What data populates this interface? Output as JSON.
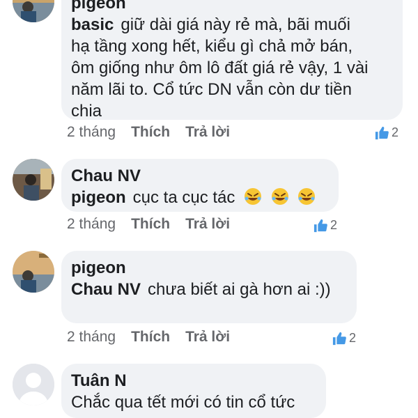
{
  "comments": [
    {
      "author": "pigeon",
      "mention": "basic",
      "lines": [
        "giữ dài giá này rẻ mà, bãi muối",
        "hạ tầng xong hết, kiểu gì chả mở bán,",
        "ôm giống như ôm lô đất giá rẻ vậy, 1 vài",
        "năm lãi to. Cổ tức DN vẫn còn dư tiền",
        "chia"
      ],
      "time": "2 tháng",
      "like_label": "Thích",
      "reply_label": "Trả lời",
      "reaction_count": "2"
    },
    {
      "author": "Chau NV",
      "mention": "pigeon",
      "text": "cục ta cục tác",
      "emojis": [
        "rolling-on-floor-laughing-emoji",
        "rolling-on-floor-laughing-emoji",
        "rolling-on-floor-laughing-emoji"
      ],
      "time": "2 tháng",
      "like_label": "Thích",
      "reply_label": "Trả lời",
      "reaction_count": "2"
    },
    {
      "author": "pigeon",
      "mention": "Chau NV",
      "text": "chưa biết ai gà hơn ai :))",
      "time": "2 tháng",
      "like_label": "Thích",
      "reply_label": "Trả lời",
      "reaction_count": "2"
    },
    {
      "author": "Tuân N",
      "text": "Chắc qua tết mới có tin cổ tức"
    }
  ],
  "colors": {
    "bubble_bg": "#f0f2f5",
    "meta_text": "#65676b",
    "like_blue": "#1877f2"
  }
}
